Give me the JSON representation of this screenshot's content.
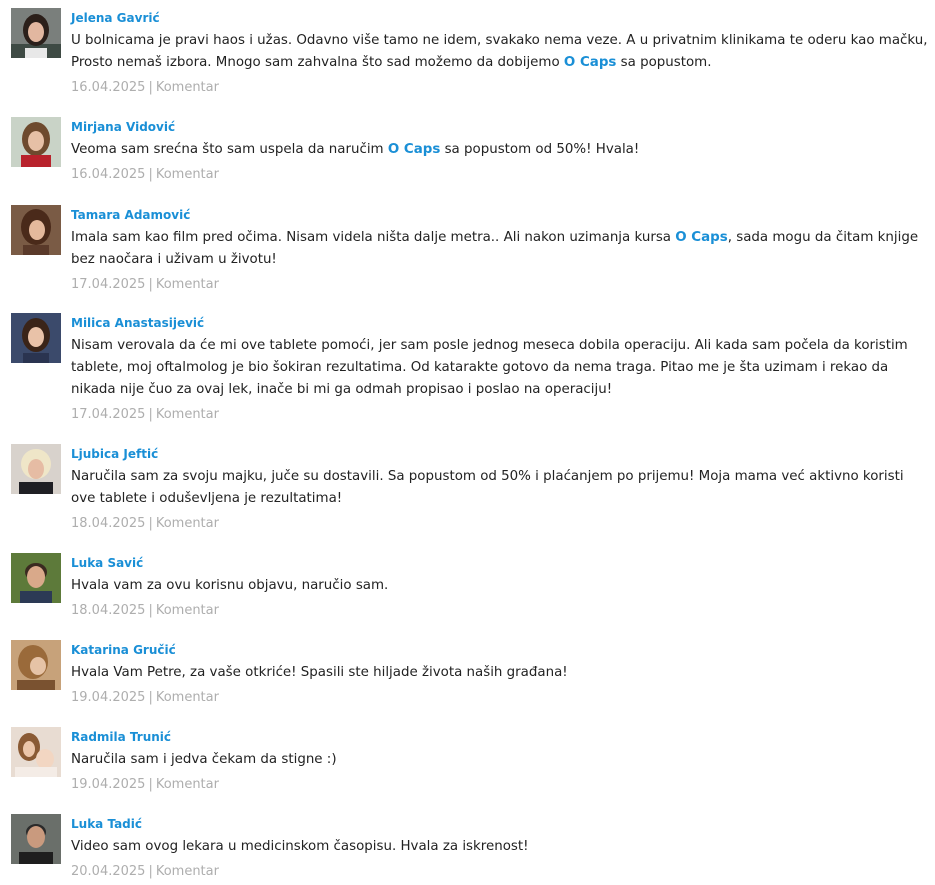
{
  "brand_name": "O Caps",
  "comment_action_label": "Komentar",
  "separator": "|",
  "colors": {
    "author_link": "#1a8fd6",
    "text": "#222222",
    "meta": "#aeaeae"
  },
  "comments": [
    {
      "author": "Jelena Gavrić",
      "text_before": "U bolnicama je pravi haos i užas. Odavno više tamo ne idem, svakako nema veze. A u privatnim klinikama te oderu kao mačku, Prosto nemaš izbora. Mnogo sam zahvalna što sad možemo da dobijemo ",
      "brand": "O Caps",
      "text_after": " sa popustom.",
      "date": "16.04.2025",
      "avatar": "photo-of-commenter-icon"
    },
    {
      "author": "Mirjana Vidović",
      "text_before": "Veoma sam srećna što sam uspela da naručim ",
      "brand": "O Caps",
      "text_after": " sa popustom od 50%! Hvala!",
      "date": "16.04.2025",
      "avatar": "photo-of-commenter-icon"
    },
    {
      "author": "Tamara Adamović",
      "text_before": "Imala sam kao film pred očima. Nisam videla ništa dalje metra.. Ali nakon uzimanja kursa ",
      "brand": "O Caps",
      "text_after": ", sada mogu da čitam knjige bez naočara i uživam u životu!",
      "date": "17.04.2025",
      "avatar": "photo-of-commenter-icon"
    },
    {
      "author": "Milica Anastasijević",
      "text_before": "Nisam verovala da će mi ove tablete pomoći, jer sam posle jednog meseca dobila operaciju. Ali kada sam počela da koristim tablete, moj oftalmolog je bio šokiran rezultatima. Od katarakte gotovo da nema traga. Pitao me je šta uzimam i rekao da nikada nije čuo za ovaj lek, inače bi mi ga odmah propisao i poslao na operaciju!",
      "brand": "",
      "text_after": "",
      "date": "17.04.2025",
      "avatar": "photo-of-commenter-icon"
    },
    {
      "author": "Ljubica Jeftić",
      "text_before": "Naručila sam za svoju majku, juče su dostavili. Sa popustom od 50% i plaćanjem po prijemu! Moja mama već aktivno koristi ove tablete i oduševljena je rezultatima!",
      "brand": "",
      "text_after": "",
      "date": "18.04.2025",
      "avatar": "photo-of-commenter-icon"
    },
    {
      "author": "Luka Savić",
      "text_before": "Hvala vam za ovu korisnu objavu, naručio sam.",
      "brand": "",
      "text_after": "",
      "date": "18.04.2025",
      "avatar": "photo-of-commenter-icon"
    },
    {
      "author": "Katarina Gručić",
      "text_before": "Hvala Vam Petre, za vaše otkriće! Spasili ste hiljade života naših građana!",
      "brand": "",
      "text_after": "",
      "date": "19.04.2025",
      "avatar": "photo-of-commenter-icon"
    },
    {
      "author": "Radmila Trunić",
      "text_before": "Naručila sam i jedva čekam da stigne :)",
      "brand": "",
      "text_after": "",
      "date": "19.04.2025",
      "avatar": "photo-of-commenter-icon"
    },
    {
      "author": "Luka Tadić",
      "text_before": "Video sam ovog lekara u medicinskom časopisu. Hvala za iskrenost!",
      "brand": "",
      "text_after": "",
      "date": "20.04.2025",
      "avatar": "photo-of-commenter-icon"
    }
  ]
}
